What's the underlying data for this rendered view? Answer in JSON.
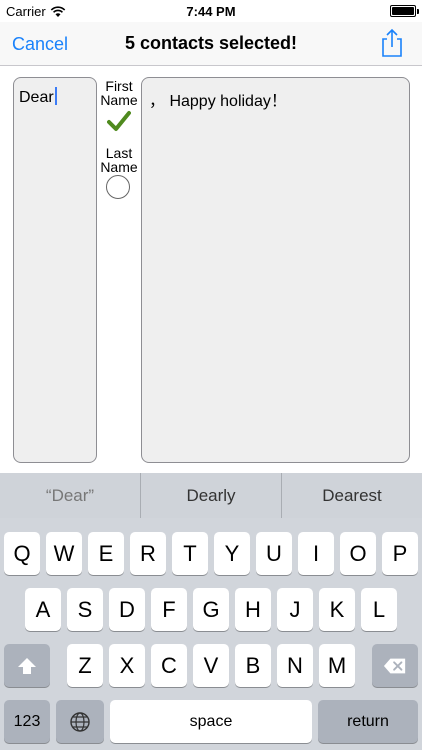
{
  "status": {
    "carrier": "Carrier",
    "time": "7:44 PM"
  },
  "nav": {
    "cancel_label": "Cancel",
    "title": "5 contacts selected!"
  },
  "composer": {
    "greeting": "Dear",
    "first_name_label": "First Name",
    "last_name_label": "Last Name",
    "message": "， Happy holiday！"
  },
  "suggestions": [
    "“Dear”",
    "Dearly",
    "Dearest"
  ],
  "keyboard": {
    "row1": [
      "Q",
      "W",
      "E",
      "R",
      "T",
      "Y",
      "U",
      "I",
      "O",
      "P"
    ],
    "row2": [
      "A",
      "S",
      "D",
      "F",
      "G",
      "H",
      "J",
      "K",
      "L"
    ],
    "row3": [
      "Z",
      "X",
      "C",
      "V",
      "B",
      "N",
      "M"
    ],
    "numbers_label": "123",
    "space_label": "space",
    "return_label": "return"
  },
  "colors": {
    "accent": "#1a82fb",
    "check": "#4f8a1e"
  },
  "icons": [
    "wifi-icon",
    "battery-icon",
    "share-icon",
    "check-icon",
    "shift-icon",
    "delete-icon",
    "globe-icon"
  ]
}
